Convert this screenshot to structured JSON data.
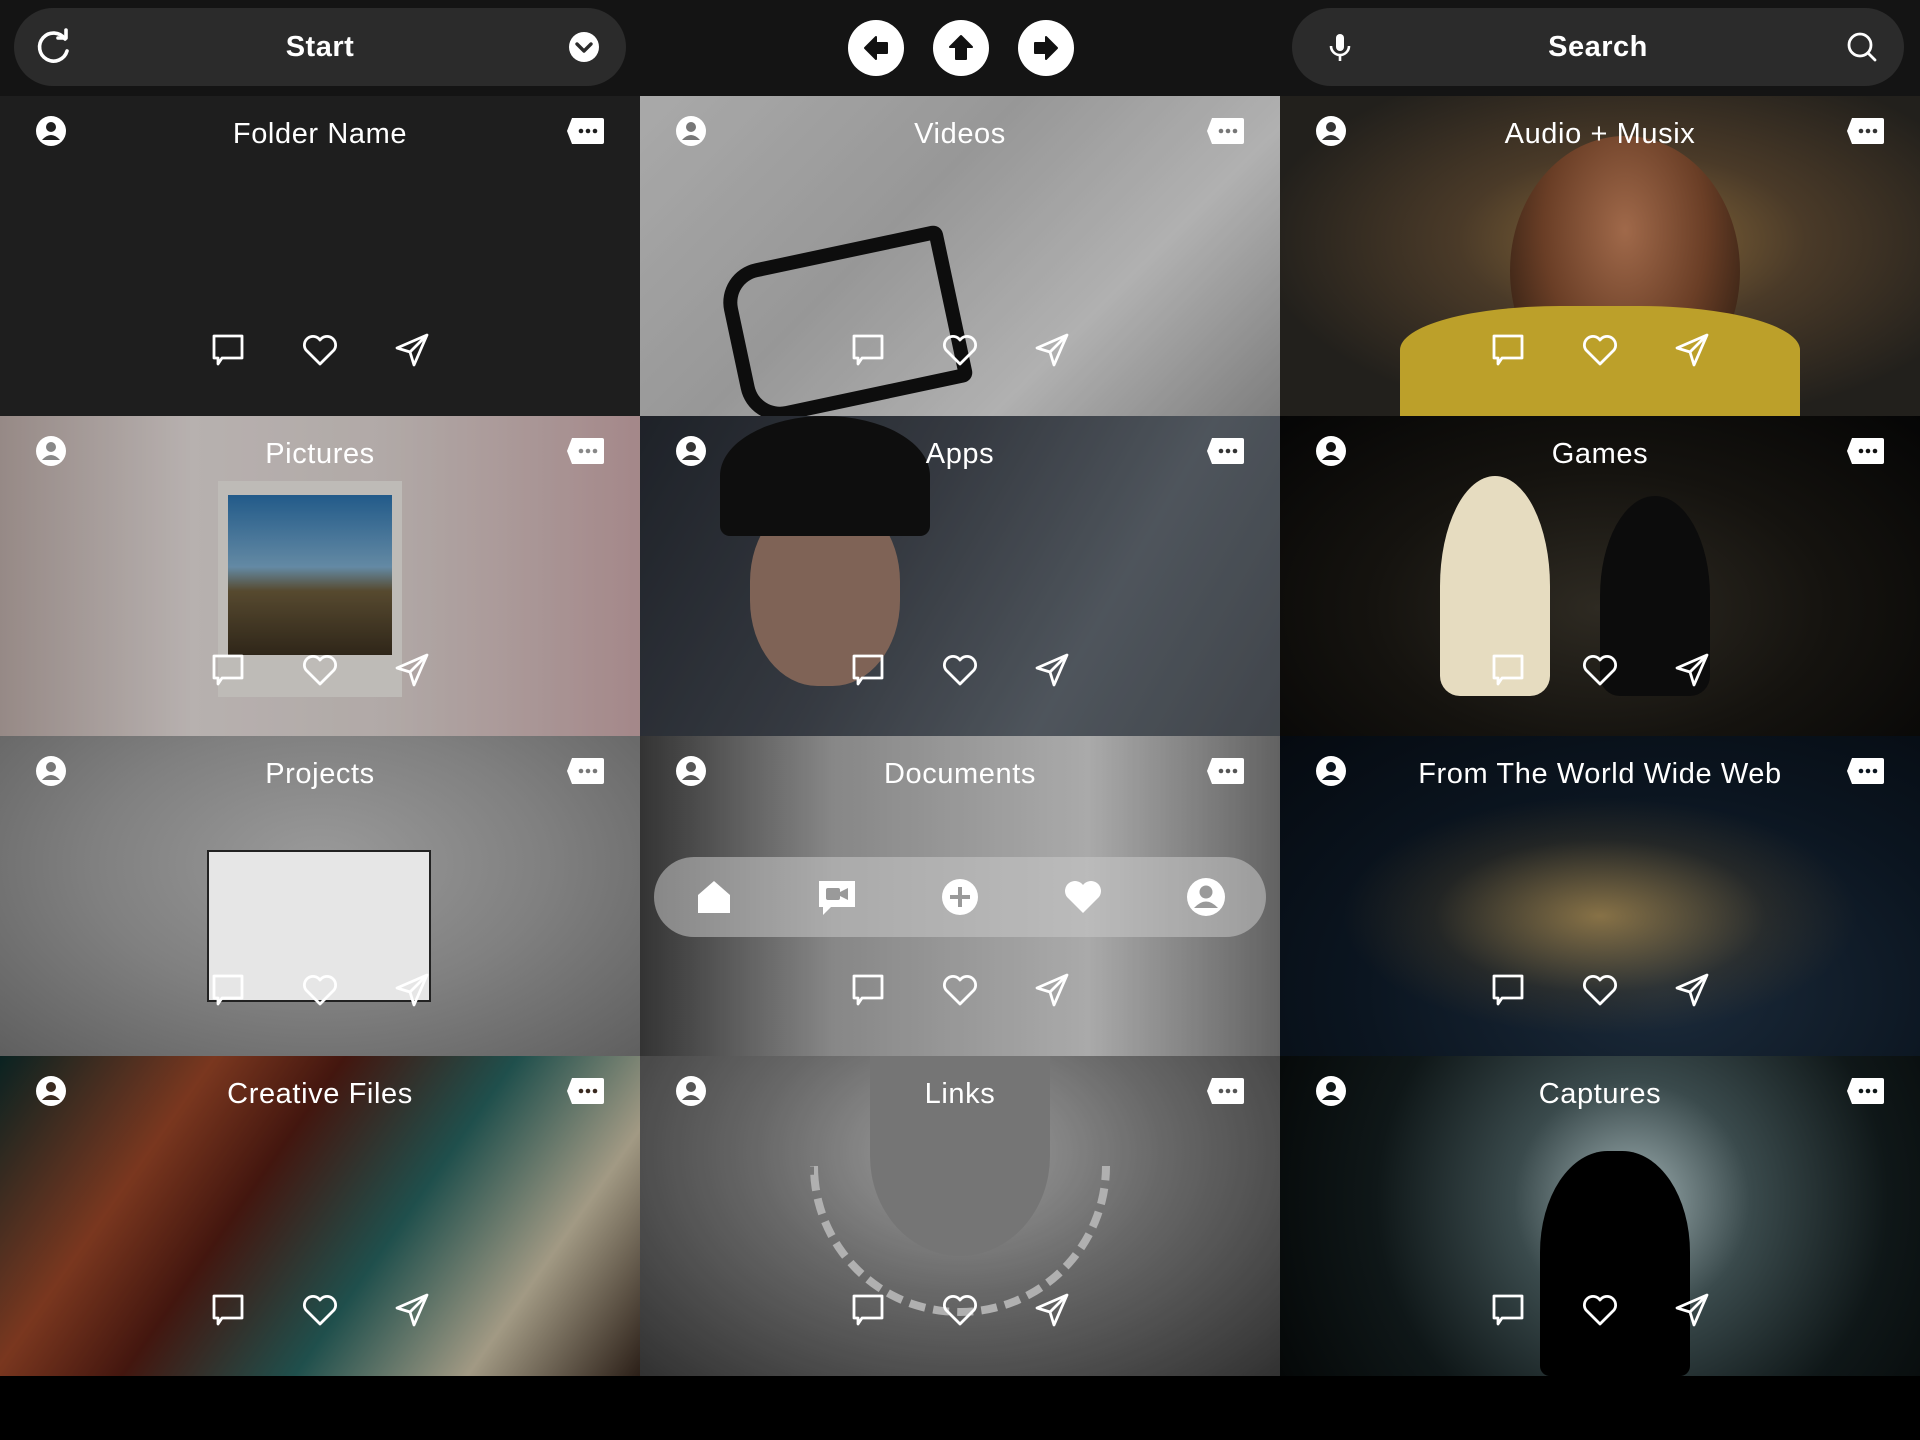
{
  "toolbar": {
    "start_label": "Start",
    "search_label": "Search",
    "left_icon": "refresh-icon",
    "start_dropdown_icon": "chevron-down-icon",
    "mic_icon": "microphone-icon",
    "search_icon": "search-icon",
    "nav": [
      {
        "icon": "arrow-left-icon"
      },
      {
        "icon": "arrow-up-icon"
      },
      {
        "icon": "arrow-right-icon"
      }
    ]
  },
  "tiles": [
    {
      "title": "Folder Name"
    },
    {
      "title": "Videos"
    },
    {
      "title": "Audio + Musix"
    },
    {
      "title": "Pictures"
    },
    {
      "title": "Apps"
    },
    {
      "title": "Games"
    },
    {
      "title": "Projects"
    },
    {
      "title": "Documents"
    },
    {
      "title": "From The World Wide Web"
    },
    {
      "title": "Creative Files"
    },
    {
      "title": "Links"
    },
    {
      "title": "Captures"
    }
  ],
  "tile_icons": {
    "owner": "user-circle-icon",
    "more": "more-options-icon",
    "actions": [
      "comment-icon",
      "heart-icon",
      "send-icon"
    ]
  },
  "dock": {
    "items": [
      "home-icon",
      "video-chat-icon",
      "add-icon",
      "heart-icon",
      "profile-icon"
    ]
  },
  "colors": {
    "topbar": "#141414",
    "pill": "#2b2b2b",
    "text": "#ffffff",
    "dock": "#c8c8c8"
  }
}
